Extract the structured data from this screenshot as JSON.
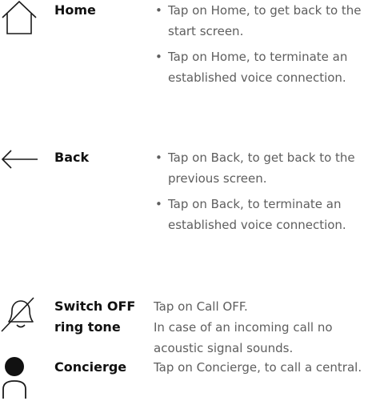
{
  "rows": [
    {
      "label": "Home",
      "icon": "home-icon",
      "bullets": [
        "Tap on Home, to get back to the start screen.",
        "Tap on Home, to terminate an established voice connection."
      ]
    },
    {
      "label": "Back",
      "icon": "arrow-left-icon",
      "bullets": [
        "Tap on Back, to get back to the previous screen.",
        "Tap on Back, to terminate an established voice connection."
      ]
    },
    {
      "label": "Switch OFF ring tone",
      "icon": "bell-off-icon",
      "lines": [
        "Tap on Call OFF.",
        "In case of an incoming call no acoustic signal sounds."
      ]
    },
    {
      "label": "Concierge",
      "icon": "person-icon",
      "lines": [
        "Tap on Concierge, to call a central."
      ]
    }
  ],
  "bullet_glyph": "•"
}
